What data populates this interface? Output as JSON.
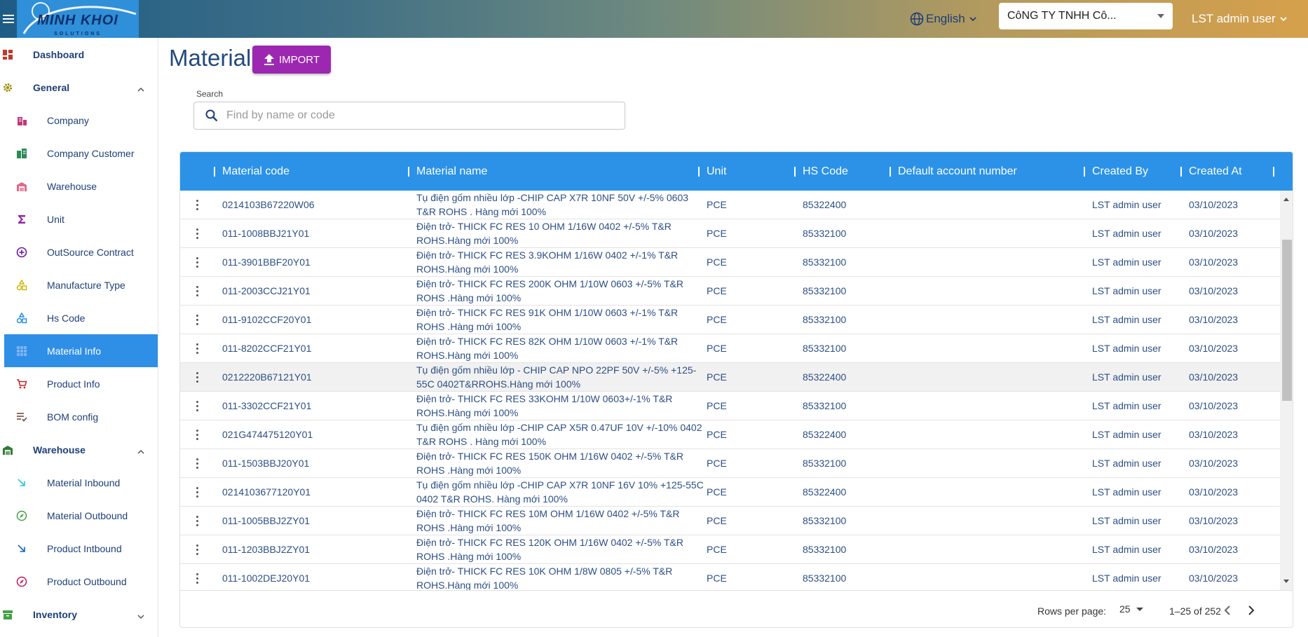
{
  "header": {
    "logo_text": "MINH KHOI",
    "logo_sub": "SOLUTIONS",
    "language": "English",
    "company": "CôNG TY TNHH Cô...",
    "user": "LST admin user"
  },
  "sidebar": {
    "items": [
      {
        "label": "Dashboard",
        "icon": "dashboard-icon",
        "type": "section",
        "color": "#c0392b"
      },
      {
        "label": "General",
        "icon": "gear-icon",
        "type": "section",
        "color": "#9a8a00",
        "expanded": true
      },
      {
        "label": "Company",
        "icon": "company-icon",
        "type": "sub",
        "color": "#c0387a"
      },
      {
        "label": "Company Customer",
        "icon": "company-customer-icon",
        "type": "sub",
        "color": "#2e8b57"
      },
      {
        "label": "Warehouse",
        "icon": "warehouse-icon",
        "type": "sub",
        "color": "#e06a8a"
      },
      {
        "label": "Unit",
        "icon": "sigma-icon",
        "type": "sub",
        "color": "#8e24aa"
      },
      {
        "label": "OutSource Contract",
        "icon": "plus-circle-icon",
        "type": "sub",
        "color": "#6a1b9a"
      },
      {
        "label": "Manufacture Type",
        "icon": "shapes-icon",
        "type": "sub",
        "color": "#c9b400"
      },
      {
        "label": "Hs Code",
        "icon": "shapes-icon",
        "type": "sub",
        "color": "#1e88e5"
      },
      {
        "label": "Material Info",
        "icon": "grid-icon",
        "type": "sub",
        "color": "#5c6bc0",
        "active": true
      },
      {
        "label": "Product Info",
        "icon": "cart-icon",
        "type": "sub",
        "color": "#c62828"
      },
      {
        "label": "BOM config",
        "icon": "list-check-icon",
        "type": "sub",
        "color": "#6d4c41"
      },
      {
        "label": "Warehouse",
        "icon": "warehouse-icon",
        "type": "section",
        "color": "#2e7d32",
        "expanded": true
      },
      {
        "label": "Material Inbound",
        "icon": "arrow-down-right-icon",
        "type": "sub",
        "color": "#26c6da"
      },
      {
        "label": "Material Outbound",
        "icon": "compass-icon",
        "type": "sub",
        "color": "#43a047"
      },
      {
        "label": "Product Intbound",
        "icon": "arrow-down-right-icon",
        "type": "sub",
        "color": "#1565c0"
      },
      {
        "label": "Product Outbound",
        "icon": "compass-icon",
        "type": "sub",
        "color": "#c2185b"
      },
      {
        "label": "Inventory",
        "icon": "inventory-icon",
        "type": "section",
        "color": "#43a047",
        "expanded": false
      }
    ]
  },
  "main": {
    "title": "Material",
    "import_label": "IMPORT",
    "search_label": "Search",
    "search_placeholder": "Find by name or code"
  },
  "table": {
    "columns": [
      "Material code",
      "Material name",
      "Unit",
      "HS Code",
      "Default account number",
      "Created By",
      "Created At"
    ],
    "rows": [
      {
        "code": "0214103B67220W06",
        "name": "Tụ điện gốm nhiều lớp -CHIP CAP X7R 10NF 50V +/-5% 0603 T&R ROHS . Hàng mới 100%",
        "unit": "PCE",
        "hs": "85322400",
        "account": "",
        "by": "LST admin user",
        "at": "03/10/2023"
      },
      {
        "code": "011-1008BBJ21Y01",
        "name": "Điện trở- THICK FC RES 10 OHM 1/16W 0402 +/-5% T&R ROHS.Hàng mới 100%",
        "unit": "PCE",
        "hs": "85332100",
        "account": "",
        "by": "LST admin user",
        "at": "03/10/2023"
      },
      {
        "code": "011-3901BBF20Y01",
        "name": "Điện trở- THICK FC RES 3.9KOHM 1/16W 0402 +/-1% T&R ROHS.Hàng mới 100%",
        "unit": "PCE",
        "hs": "85332100",
        "account": "",
        "by": "LST admin user",
        "at": "03/10/2023"
      },
      {
        "code": "011-2003CCJ21Y01",
        "name": "Điện trở- THICK FC RES 200K OHM 1/10W 0603 +/-5% T&R ROHS .Hàng mới 100%",
        "unit": "PCE",
        "hs": "85332100",
        "account": "",
        "by": "LST admin user",
        "at": "03/10/2023"
      },
      {
        "code": "011-9102CCF20Y01",
        "name": "Điện trở- THICK FC RES 91K OHM 1/10W 0603 +/-1% T&R ROHS .Hàng mới 100%",
        "unit": "PCE",
        "hs": "85332100",
        "account": "",
        "by": "LST admin user",
        "at": "03/10/2023"
      },
      {
        "code": "011-8202CCF21Y01",
        "name": "Điện trở- THICK FC RES 82K OHM 1/10W 0603 +/-1% T&R ROHS.Hàng mới 100%",
        "unit": "PCE",
        "hs": "85332100",
        "account": "",
        "by": "LST admin user",
        "at": "03/10/2023"
      },
      {
        "code": "0212220B67121Y01",
        "name": "Tụ điện gốm nhiều lớp - CHIP CAP NPO 22PF 50V +/-5% +125-55C 0402T&RROHS.Hàng mới 100%",
        "unit": "PCE",
        "hs": "85322400",
        "account": "",
        "by": "LST admin user",
        "at": "03/10/2023"
      },
      {
        "code": "011-3302CCF21Y01",
        "name": "Điện trở- THICK FC RES 33KOHM 1/10W 0603+/-1% T&R ROHS.Hàng mới 100%",
        "unit": "PCE",
        "hs": "85332100",
        "account": "",
        "by": "LST admin user",
        "at": "03/10/2023"
      },
      {
        "code": "021G474475120Y01",
        "name": "Tụ điện gốm nhiều lớp -CHIP CAP X5R 0.47UF 10V +/-10% 0402 T&R ROHS . Hàng mới 100%",
        "unit": "PCE",
        "hs": "85322400",
        "account": "",
        "by": "LST admin user",
        "at": "03/10/2023"
      },
      {
        "code": "011-1503BBJ20Y01",
        "name": "Điện trở- THICK FC RES 150K OHM 1/16W 0402 +/-5% T&R ROHS .Hàng mới 100%",
        "unit": "PCE",
        "hs": "85332100",
        "account": "",
        "by": "LST admin user",
        "at": "03/10/2023"
      },
      {
        "code": "0214103677120Y01",
        "name": "Tụ điện gốm nhiều lớp -CHIP CAP X7R 10NF 16V 10% +125-55C 0402 T&R ROHS. Hàng mới 100%",
        "unit": "PCE",
        "hs": "85322400",
        "account": "",
        "by": "LST admin user",
        "at": "03/10/2023"
      },
      {
        "code": "011-1005BBJ2ZY01",
        "name": "Điện trở- THICK FC RES 10M OHM 1/16W 0402 +/-5% T&R ROHS .Hàng mới 100%",
        "unit": "PCE",
        "hs": "85332100",
        "account": "",
        "by": "LST admin user",
        "at": "03/10/2023"
      },
      {
        "code": "011-1203BBJ2ZY01",
        "name": "Điện trở- THICK FC RES 120K OHM 1/16W 0402 +/-5% T&R ROHS .Hàng mới 100%",
        "unit": "PCE",
        "hs": "85332100",
        "account": "",
        "by": "LST admin user",
        "at": "03/10/2023"
      },
      {
        "code": "011-1002DEJ20Y01",
        "name": "Điện trở- THICK FC RES 10K OHM 1/8W 0805 +/-5% T&R ROHS.Hàng mới 100%",
        "unit": "PCE",
        "hs": "85332100",
        "account": "",
        "by": "LST admin user",
        "at": "03/10/2023"
      }
    ],
    "highlighted_row": 6
  },
  "pagination": {
    "rows_per_page_label": "Rows per page:",
    "rows_per_page": "25",
    "range": "1–25 of 252"
  },
  "colors": {
    "accent": "#2b92e8",
    "import": "#9c27b0",
    "title": "#23497f"
  }
}
